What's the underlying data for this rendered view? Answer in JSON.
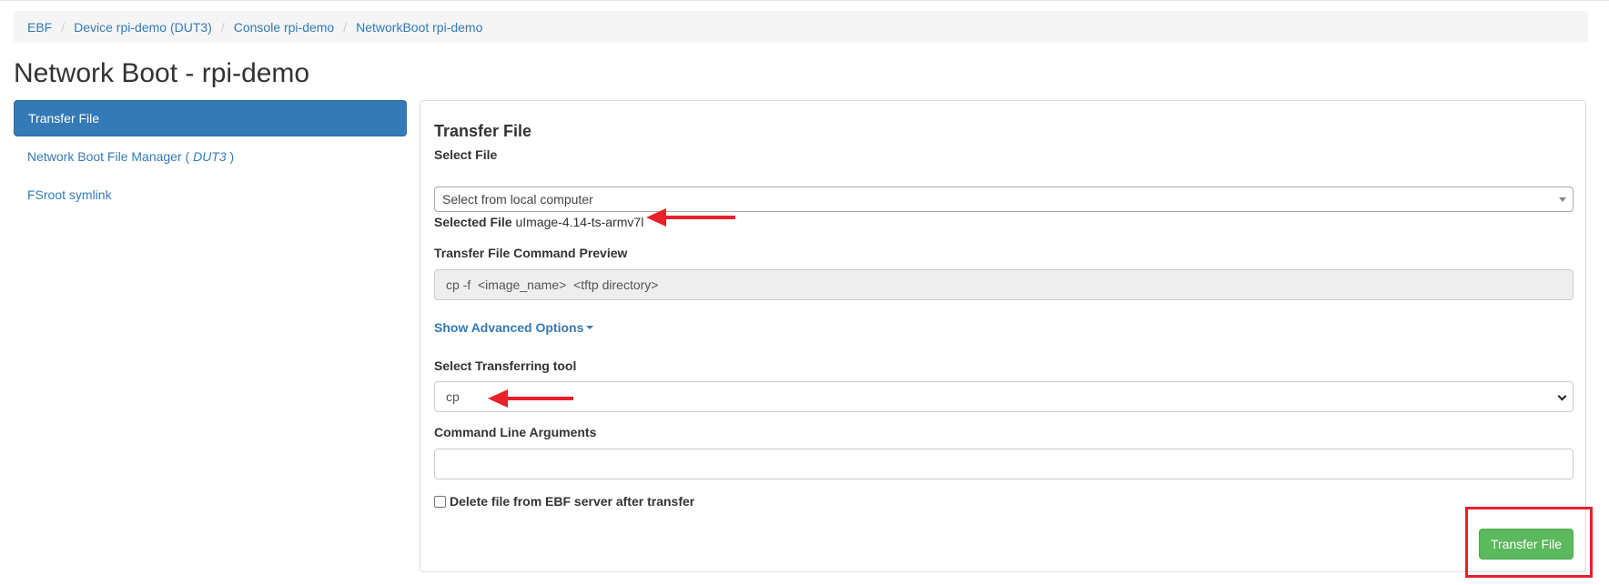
{
  "breadcrumb": {
    "items": [
      "EBF",
      "Device rpi-demo (DUT3)",
      "Console rpi-demo",
      "NetworkBoot rpi-demo"
    ],
    "separator": "/"
  },
  "page": {
    "title": "Network Boot - rpi-demo"
  },
  "sidebar": {
    "items": [
      {
        "label": "Transfer File",
        "active": true
      },
      {
        "label_prefix": "Network Boot File Manager ( ",
        "label_em": "DUT3",
        "label_suffix": " )",
        "active": false
      },
      {
        "label": "FSroot symlink",
        "active": false
      }
    ]
  },
  "panel": {
    "title": "Transfer File",
    "select_file": {
      "label": "Select File",
      "value": "Select from local computer"
    },
    "selected_file": {
      "label": "Selected File",
      "value": "uImage-4.14-ts-armv7l"
    },
    "command_preview": {
      "label": "Transfer File Command Preview",
      "value": "cp -f  <image_name>  <tftp directory>"
    },
    "advanced_options": {
      "label": "Show Advanced Options"
    },
    "transfer_tool": {
      "label": "Select Transferring tool",
      "value": "cp"
    },
    "cmd_args": {
      "label": "Command Line Arguments",
      "value": ""
    },
    "delete_after": {
      "label": "Delete file from EBF server after transfer",
      "checked": false
    },
    "submit": {
      "label": "Transfer File"
    }
  },
  "colors": {
    "link": "#337ab7",
    "active_bg": "#337ab7",
    "success": "#5cb85c",
    "annotation": "#e8202a"
  }
}
